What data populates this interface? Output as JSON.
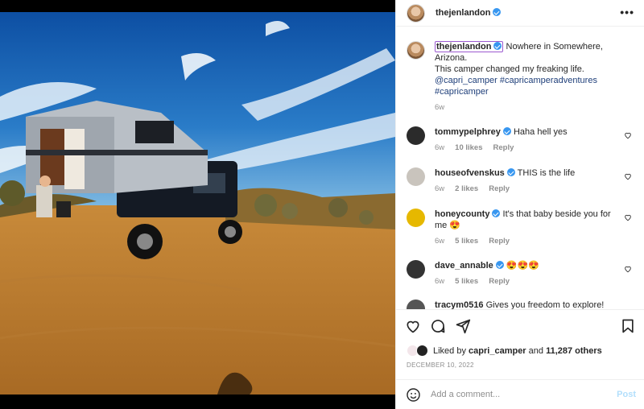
{
  "post": {
    "username": "thejenlandon",
    "more_label": "•••"
  },
  "caption": {
    "username": "thejenlandon",
    "line1": "Nowhere in Somewhere,",
    "line2": "Arizona.",
    "line3": "This camper changed my freaking life.",
    "tag1": "@capri_camper",
    "tag2": "#capricamperadventures",
    "tag3": "#capricamper",
    "time": "6w"
  },
  "comments": [
    {
      "username": "tommypelphrey",
      "verified": true,
      "text": "Haha hell yes",
      "time": "6w",
      "likes": "10 likes",
      "reply": "Reply",
      "avatar_color": "#2b2b2b"
    },
    {
      "username": "houseofvenskus",
      "verified": true,
      "text": "THIS is the life",
      "time": "6w",
      "likes": "2 likes",
      "reply": "Reply",
      "avatar_color": "#c9c4bd"
    },
    {
      "username": "honeycounty",
      "verified": true,
      "text": "It's that baby beside you for me 😍",
      "time": "6w",
      "likes": "5 likes",
      "reply": "Reply",
      "avatar_color": "#e6b800"
    },
    {
      "username": "dave_annable",
      "verified": true,
      "text": "😍😍😍",
      "time": "6w",
      "likes": "5 likes",
      "reply": "Reply",
      "avatar_color": "#333333"
    },
    {
      "username": "tracym0516",
      "verified": false,
      "text": "Gives you freedom to explore!",
      "time": "",
      "likes": "",
      "reply": "",
      "avatar_color": "#555555"
    }
  ],
  "likes": {
    "prefix": "Liked by",
    "user": "capri_camper",
    "and": "and",
    "count": "11,287 others"
  },
  "date": "DECEMBER 10, 2022",
  "add_comment": {
    "placeholder": "Add a comment...",
    "post_label": "Post"
  },
  "colors": {
    "accent": "#3897f0",
    "post_disabled": "#b2dffc",
    "link": "#1f3f7a"
  },
  "icons": [
    "more-icon",
    "heart-icon",
    "comment-icon",
    "share-icon",
    "bookmark-icon",
    "emoji-icon",
    "verified-icon"
  ]
}
